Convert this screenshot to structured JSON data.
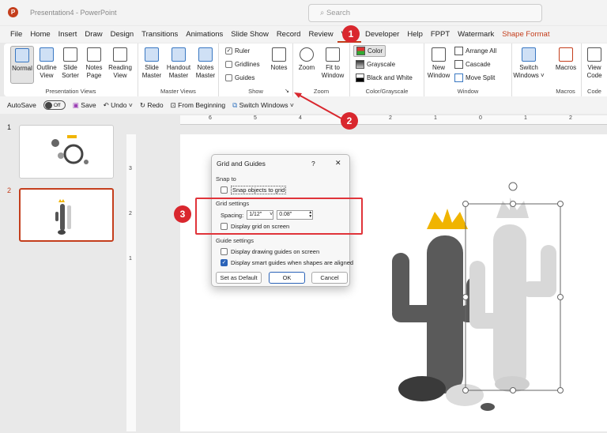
{
  "window": {
    "title": "Presentation4 - PowerPoint",
    "logo": "P",
    "search_placeholder": "Search"
  },
  "tabs": [
    "File",
    "Home",
    "Insert",
    "Draw",
    "Design",
    "Transitions",
    "Animations",
    "Slide Show",
    "Record",
    "Review",
    "View",
    "Developer",
    "Help",
    "FPPT",
    "Watermark",
    "Shape Format"
  ],
  "ribbon": {
    "presentation_views": {
      "label": "Presentation Views",
      "buttons": [
        "Normal",
        "Outline View",
        "Slide Sorter",
        "Notes Page",
        "Reading View"
      ]
    },
    "master_views": {
      "label": "Master Views",
      "buttons": [
        "Slide Master",
        "Handout Master",
        "Notes Master"
      ]
    },
    "show": {
      "label": "Show",
      "ruler": "Ruler",
      "gridlines": "Gridlines",
      "guides": "Guides",
      "notes": "Notes"
    },
    "zoom": {
      "label": "Zoom",
      "zoom": "Zoom",
      "fit": "Fit to Window"
    },
    "color": {
      "label": "Color/Grayscale",
      "color": "Color",
      "grayscale": "Grayscale",
      "bw": "Black and White"
    },
    "window": {
      "label": "Window",
      "new": "New Window",
      "arrange": "Arrange All",
      "cascade": "Cascade",
      "move_split": "Move Split",
      "switch": "Switch Windows"
    },
    "macros": {
      "label": "Macros",
      "macros": "Macros"
    },
    "code": {
      "label": "Code",
      "view_code": "View Code"
    }
  },
  "qat": {
    "autosave": "AutoSave",
    "toggle": "Off",
    "save": "Save",
    "undo": "Undo",
    "redo": "Redo",
    "from_beginning": "From Beginning",
    "switch_windows": "Switch Windows"
  },
  "ruler_h": [
    "6",
    "5",
    "4",
    "3",
    "2",
    "1",
    "0",
    "1",
    "2"
  ],
  "ruler_v": [
    "3",
    "2",
    "1"
  ],
  "slides": [
    "1",
    "2"
  ],
  "dialog": {
    "title": "Grid and Guides",
    "help": "?",
    "close": "✕",
    "snap_to": "Snap to",
    "snap_objects": "Snap objects to grid",
    "grid_settings": "Grid settings",
    "spacing_label": "Spacing:",
    "spacing_value": "1/12\"",
    "spacing_custom": "0.08\"",
    "display_grid": "Display grid on screen",
    "guide_settings": "Guide settings",
    "drawing_guides": "Display drawing guides on screen",
    "smart_guides": "Display smart guides when shapes are aligned",
    "set_default": "Set as Default",
    "ok": "OK",
    "cancel": "Cancel"
  },
  "annotations": [
    "1",
    "2",
    "3"
  ],
  "colors": {
    "accent": "#c43e1c",
    "annotation": "#d9272e"
  }
}
